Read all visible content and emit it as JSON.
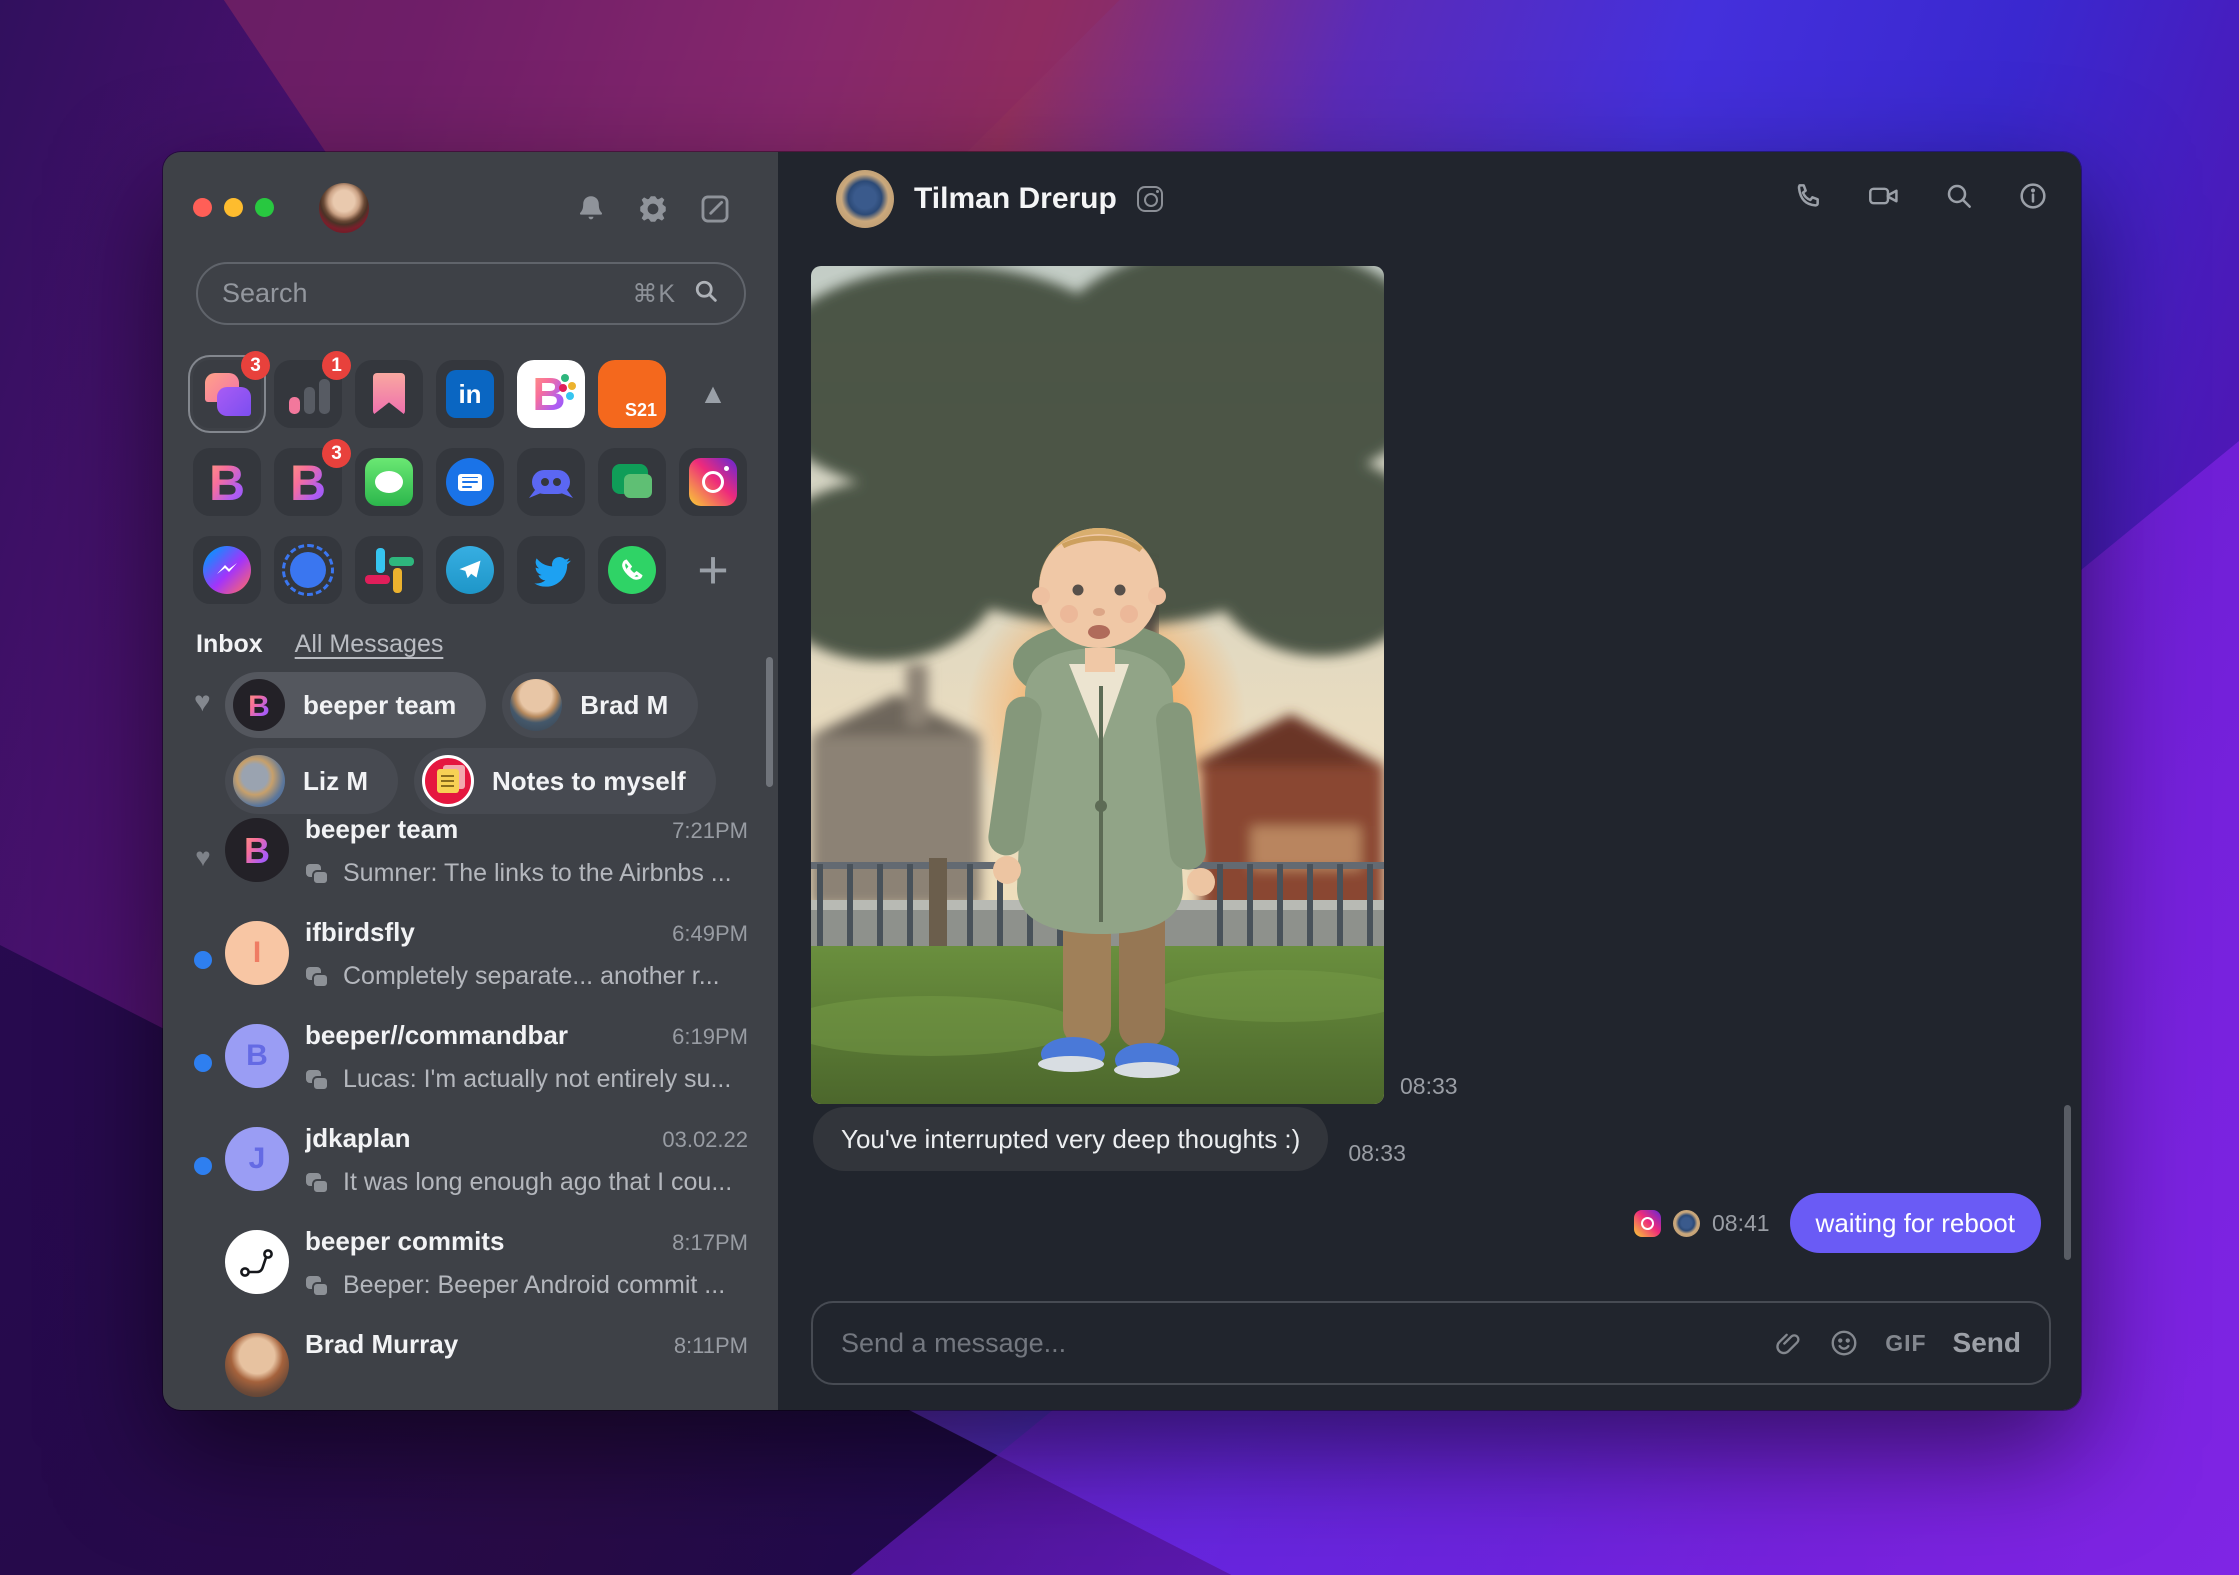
{
  "sidebar": {
    "search": {
      "placeholder": "Search",
      "shortcut": "⌘K"
    },
    "inbox_label": "Inbox",
    "all_messages_label": "All Messages",
    "apps": [
      {
        "name": "beeper-all-chats",
        "badge": "3"
      },
      {
        "name": "analytics",
        "badge": "1"
      },
      {
        "name": "bookmarks"
      },
      {
        "name": "linkedin",
        "glyph": "in"
      },
      {
        "name": "beeper-workspace",
        "glyph": "B"
      },
      {
        "name": "s21",
        "label": "S21"
      },
      {
        "name": "collapse-grid"
      },
      {
        "name": "beeper",
        "glyph": "B"
      },
      {
        "name": "beeper-unread",
        "glyph": "B",
        "badge": "3"
      },
      {
        "name": "imessage"
      },
      {
        "name": "android-messages"
      },
      {
        "name": "discord"
      },
      {
        "name": "google-chat"
      },
      {
        "name": "instagram"
      },
      {
        "name": "messenger"
      },
      {
        "name": "signal"
      },
      {
        "name": "slack"
      },
      {
        "name": "telegram"
      },
      {
        "name": "twitter"
      },
      {
        "name": "whatsapp"
      },
      {
        "name": "add-network"
      }
    ],
    "favorites": [
      {
        "label": "beeper team",
        "initial": "B"
      },
      {
        "label": "Brad M"
      },
      {
        "label": "Liz M"
      },
      {
        "label": "Notes to myself"
      }
    ],
    "chats": [
      {
        "name": "beeper team",
        "time": "7:21PM",
        "preview": "Sumner: The links to the Airbnbs ...",
        "initial": "B"
      },
      {
        "name": "ifbirdsfly",
        "time": "6:49PM",
        "preview": "Completely separate... another r...",
        "initial": "I"
      },
      {
        "name": "beeper//commandbar",
        "time": "6:19PM",
        "preview": "Lucas: I'm actually not entirely su...",
        "initial": "B"
      },
      {
        "name": "jdkaplan",
        "time": "03.02.22",
        "preview": "It was long enough ago that I cou...",
        "initial": "J"
      },
      {
        "name": "beeper commits",
        "time": "8:17PM",
        "preview": "Beeper: Beeper Android commit ...",
        "initial": ""
      },
      {
        "name": "Brad Murray",
        "time": "8:11PM",
        "preview": "",
        "initial": ""
      }
    ]
  },
  "chat": {
    "title": "Tilman Drerup",
    "photo_message_time": "08:33",
    "text_message": "You've interrupted very deep thoughts :)",
    "text_message_time": "08:33",
    "outgoing_message": "waiting for reboot",
    "outgoing_time": "08:41",
    "composer": {
      "placeholder": "Send a message...",
      "gif_label": "GIF",
      "send_label": "Send"
    }
  },
  "colors": {
    "accent_bubble": "#6a5bf5",
    "unread_dot": "#2e7ff0",
    "badge_red": "#e8413c",
    "sidebar_bg": "#3e4147",
    "chat_bg": "#21252d"
  }
}
